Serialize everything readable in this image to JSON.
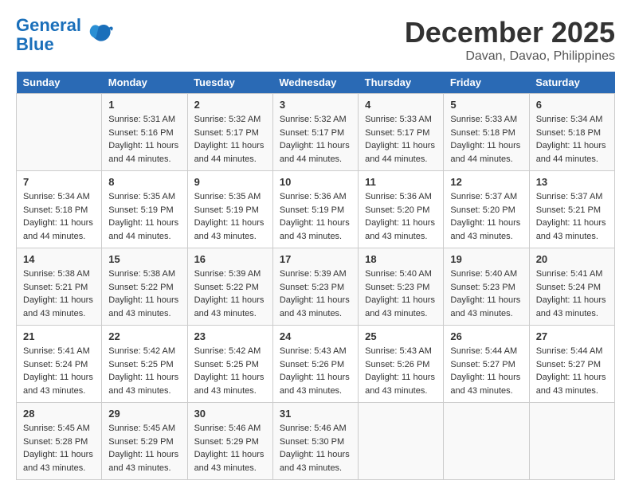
{
  "header": {
    "logo_line1": "General",
    "logo_line2": "Blue",
    "month_year": "December 2025",
    "location": "Davan, Davao, Philippines"
  },
  "days_of_week": [
    "Sunday",
    "Monday",
    "Tuesday",
    "Wednesday",
    "Thursday",
    "Friday",
    "Saturday"
  ],
  "weeks": [
    [
      {
        "day": "",
        "info": ""
      },
      {
        "day": "1",
        "info": "Sunrise: 5:31 AM\nSunset: 5:16 PM\nDaylight: 11 hours\nand 44 minutes."
      },
      {
        "day": "2",
        "info": "Sunrise: 5:32 AM\nSunset: 5:17 PM\nDaylight: 11 hours\nand 44 minutes."
      },
      {
        "day": "3",
        "info": "Sunrise: 5:32 AM\nSunset: 5:17 PM\nDaylight: 11 hours\nand 44 minutes."
      },
      {
        "day": "4",
        "info": "Sunrise: 5:33 AM\nSunset: 5:17 PM\nDaylight: 11 hours\nand 44 minutes."
      },
      {
        "day": "5",
        "info": "Sunrise: 5:33 AM\nSunset: 5:18 PM\nDaylight: 11 hours\nand 44 minutes."
      },
      {
        "day": "6",
        "info": "Sunrise: 5:34 AM\nSunset: 5:18 PM\nDaylight: 11 hours\nand 44 minutes."
      }
    ],
    [
      {
        "day": "7",
        "info": "Sunrise: 5:34 AM\nSunset: 5:18 PM\nDaylight: 11 hours\nand 44 minutes."
      },
      {
        "day": "8",
        "info": "Sunrise: 5:35 AM\nSunset: 5:19 PM\nDaylight: 11 hours\nand 44 minutes."
      },
      {
        "day": "9",
        "info": "Sunrise: 5:35 AM\nSunset: 5:19 PM\nDaylight: 11 hours\nand 43 minutes."
      },
      {
        "day": "10",
        "info": "Sunrise: 5:36 AM\nSunset: 5:19 PM\nDaylight: 11 hours\nand 43 minutes."
      },
      {
        "day": "11",
        "info": "Sunrise: 5:36 AM\nSunset: 5:20 PM\nDaylight: 11 hours\nand 43 minutes."
      },
      {
        "day": "12",
        "info": "Sunrise: 5:37 AM\nSunset: 5:20 PM\nDaylight: 11 hours\nand 43 minutes."
      },
      {
        "day": "13",
        "info": "Sunrise: 5:37 AM\nSunset: 5:21 PM\nDaylight: 11 hours\nand 43 minutes."
      }
    ],
    [
      {
        "day": "14",
        "info": "Sunrise: 5:38 AM\nSunset: 5:21 PM\nDaylight: 11 hours\nand 43 minutes."
      },
      {
        "day": "15",
        "info": "Sunrise: 5:38 AM\nSunset: 5:22 PM\nDaylight: 11 hours\nand 43 minutes."
      },
      {
        "day": "16",
        "info": "Sunrise: 5:39 AM\nSunset: 5:22 PM\nDaylight: 11 hours\nand 43 minutes."
      },
      {
        "day": "17",
        "info": "Sunrise: 5:39 AM\nSunset: 5:23 PM\nDaylight: 11 hours\nand 43 minutes."
      },
      {
        "day": "18",
        "info": "Sunrise: 5:40 AM\nSunset: 5:23 PM\nDaylight: 11 hours\nand 43 minutes."
      },
      {
        "day": "19",
        "info": "Sunrise: 5:40 AM\nSunset: 5:23 PM\nDaylight: 11 hours\nand 43 minutes."
      },
      {
        "day": "20",
        "info": "Sunrise: 5:41 AM\nSunset: 5:24 PM\nDaylight: 11 hours\nand 43 minutes."
      }
    ],
    [
      {
        "day": "21",
        "info": "Sunrise: 5:41 AM\nSunset: 5:24 PM\nDaylight: 11 hours\nand 43 minutes."
      },
      {
        "day": "22",
        "info": "Sunrise: 5:42 AM\nSunset: 5:25 PM\nDaylight: 11 hours\nand 43 minutes."
      },
      {
        "day": "23",
        "info": "Sunrise: 5:42 AM\nSunset: 5:25 PM\nDaylight: 11 hours\nand 43 minutes."
      },
      {
        "day": "24",
        "info": "Sunrise: 5:43 AM\nSunset: 5:26 PM\nDaylight: 11 hours\nand 43 minutes."
      },
      {
        "day": "25",
        "info": "Sunrise: 5:43 AM\nSunset: 5:26 PM\nDaylight: 11 hours\nand 43 minutes."
      },
      {
        "day": "26",
        "info": "Sunrise: 5:44 AM\nSunset: 5:27 PM\nDaylight: 11 hours\nand 43 minutes."
      },
      {
        "day": "27",
        "info": "Sunrise: 5:44 AM\nSunset: 5:27 PM\nDaylight: 11 hours\nand 43 minutes."
      }
    ],
    [
      {
        "day": "28",
        "info": "Sunrise: 5:45 AM\nSunset: 5:28 PM\nDaylight: 11 hours\nand 43 minutes."
      },
      {
        "day": "29",
        "info": "Sunrise: 5:45 AM\nSunset: 5:29 PM\nDaylight: 11 hours\nand 43 minutes."
      },
      {
        "day": "30",
        "info": "Sunrise: 5:46 AM\nSunset: 5:29 PM\nDaylight: 11 hours\nand 43 minutes."
      },
      {
        "day": "31",
        "info": "Sunrise: 5:46 AM\nSunset: 5:30 PM\nDaylight: 11 hours\nand 43 minutes."
      },
      {
        "day": "",
        "info": ""
      },
      {
        "day": "",
        "info": ""
      },
      {
        "day": "",
        "info": ""
      }
    ]
  ]
}
